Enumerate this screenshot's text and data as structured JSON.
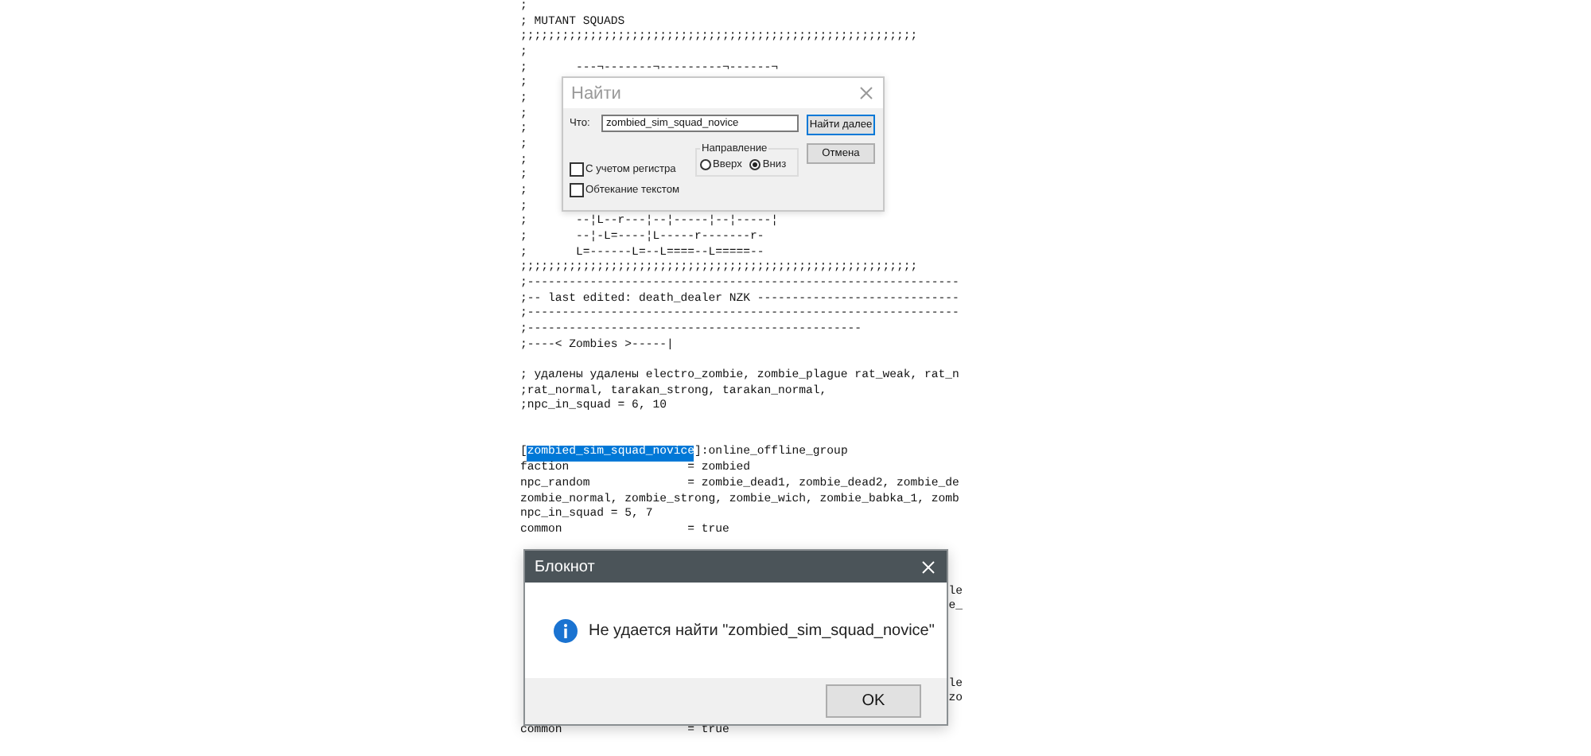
{
  "editor": {
    "lines": [
      {
        "text": ";"
      },
      {
        "text": "; MUTANT SQUADS"
      },
      {
        "text": ";;;;;;;;;;;;;;;;;;;;;;;;;;;;;;;;;;;;;;;;;;;;;;;;;;;;;;;;;"
      },
      {
        "text": ";"
      },
      {
        "text": ";       ---¬-------¬---------¬------¬"
      },
      {
        "text": ";"
      },
      {
        "text": ";"
      },
      {
        "text": ";"
      },
      {
        "text": ";"
      },
      {
        "text": ";"
      },
      {
        "text": ";"
      },
      {
        "text": ";"
      },
      {
        "text": ";"
      },
      {
        "text": ";"
      },
      {
        "text": ";       --¦L--r---¦--¦-----¦--¦-----¦"
      },
      {
        "text": ";       --¦-L=----¦L-----r-------r-"
      },
      {
        "text": ";       L=------L=--L====--L=====--"
      },
      {
        "text": ";;;;;;;;;;;;;;;;;;;;;;;;;;;;;;;;;;;;;;;;;;;;;;;;;;;;;;;;;"
      },
      {
        "text": ";--------------------------------------------------------------"
      },
      {
        "text": ";-- last edited: death_dealer NZK -----------------------------"
      },
      {
        "text": ";--------------------------------------------------------------"
      },
      {
        "text": ";------------------------------------------------"
      },
      {
        "text": ";----< Zombies >-----|"
      },
      {
        "kind": "blank"
      },
      {
        "text": "; удалены удалены electro_zombie, zombie_plague rat_weak, rat_n"
      },
      {
        "text": ";rat_normal, tarakan_strong, tarakan_normal,"
      },
      {
        "text": ";npc_in_squad = 6, 10"
      },
      {
        "kind": "blank"
      },
      {
        "kind": "blank"
      },
      {
        "kind": "selection",
        "before": "[",
        "selected": "zombied_sim_squad_novice",
        "after": "]:online_offline_group"
      },
      {
        "text": "faction                 = zombied"
      },
      {
        "text": "npc_random              = zombie_dead1, zombie_dead2, zombie_de"
      },
      {
        "text": "zombie_normal, zombie_strong, zombie_wich, zombie_babka_1, zomb"
      },
      {
        "text": "npc_in_squad = 5, 7"
      },
      {
        "text": "common                  = true"
      },
      {
        "kind": "covered"
      },
      {
        "kind": "covered"
      },
      {
        "kind": "covered"
      },
      {
        "kind": "covered",
        "tail": "le"
      },
      {
        "kind": "covered",
        "tail": "e_"
      },
      {
        "kind": "covered"
      },
      {
        "kind": "covered"
      },
      {
        "kind": "covered"
      },
      {
        "kind": "covered"
      },
      {
        "kind": "covered",
        "tail": "le"
      },
      {
        "kind": "covered",
        "tail": "zo"
      },
      {
        "kind": "covered"
      },
      {
        "text": "common                  = true"
      }
    ]
  },
  "find_dialog": {
    "title": "Найти",
    "find_label": "Что:",
    "find_value": "zombied_sim_squad_novice",
    "find_next_button": "Найти далее",
    "cancel_button": "Отмена",
    "direction": {
      "label": "Направление",
      "options": [
        {
          "label": "Вверх",
          "selected": false
        },
        {
          "label": "Вниз",
          "selected": true
        }
      ]
    },
    "checkboxes": [
      {
        "label": "С учетом регистра",
        "checked": false
      },
      {
        "label": "Обтекание текстом",
        "checked": false
      }
    ]
  },
  "message_box": {
    "title": "Блокнот",
    "message": "Не удается найти \"zombied_sim_squad_novice\"",
    "ok_button": "OK"
  }
}
